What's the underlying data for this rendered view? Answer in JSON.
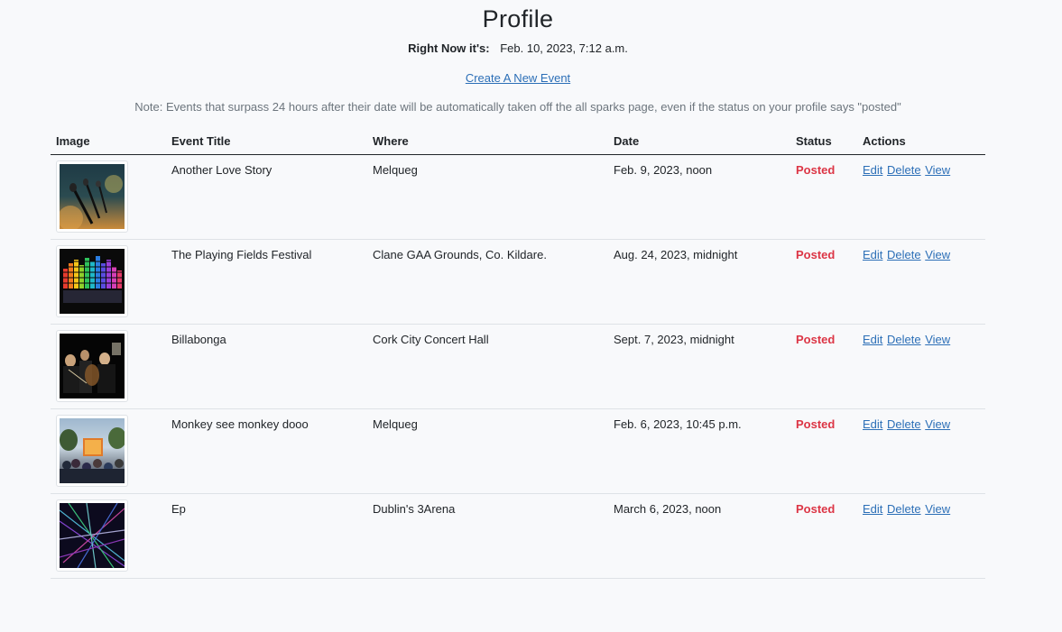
{
  "header": {
    "title": "Profile",
    "now_label": "Right Now it's:",
    "now_value": "Feb. 10, 2023, 7:12 a.m.",
    "create_link": "Create A New Event",
    "note": "Note: Events that surpass 24 hours after their date will be automatically taken off the all sparks page, even if the status on your profile says \"posted\""
  },
  "table": {
    "columns": [
      "Image",
      "Event Title",
      "Where",
      "Date",
      "Status",
      "Actions"
    ],
    "rows": [
      {
        "image": "microphones-stage-image",
        "title": "Another Love Story",
        "where": "Melqueg",
        "date": "Feb. 9, 2023, noon",
        "status": "Posted",
        "actions": [
          "Edit",
          "Delete",
          "View"
        ]
      },
      {
        "image": "rainbow-equalizer-image",
        "title": "The Playing Fields Festival",
        "where": "Clane GAA Grounds, Co. Kildare.",
        "date": "Aug. 24, 2023, midnight",
        "status": "Posted",
        "actions": [
          "Edit",
          "Delete",
          "View"
        ]
      },
      {
        "image": "orchestra-concert-image",
        "title": "Billabonga",
        "where": "Cork City Concert Hall",
        "date": "Sept. 7, 2023, midnight",
        "status": "Posted",
        "actions": [
          "Edit",
          "Delete",
          "View"
        ]
      },
      {
        "image": "outdoor-festival-crowd-image",
        "title": "Monkey see monkey dooo",
        "where": "Melqueg",
        "date": "Feb. 6, 2023, 10:45 p.m.",
        "status": "Posted",
        "actions": [
          "Edit",
          "Delete",
          "View"
        ]
      },
      {
        "image": "laser-lights-image",
        "title": "Ep",
        "where": "Dublin's 3Arena",
        "date": "March 6, 2023, noon",
        "status": "Posted",
        "actions": [
          "Edit",
          "Delete",
          "View"
        ]
      }
    ]
  },
  "colors": {
    "link": "#2c6fb7",
    "status_posted": "#dc3545",
    "background": "#f8f9fb"
  }
}
